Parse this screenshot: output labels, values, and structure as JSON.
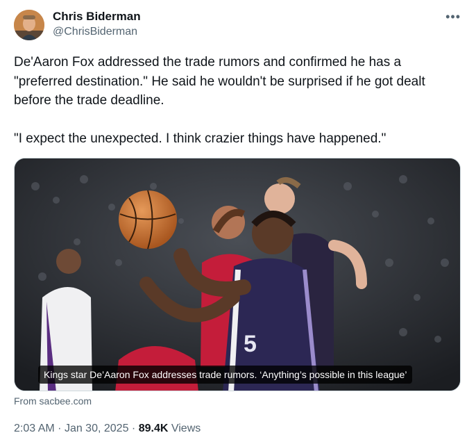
{
  "author": {
    "display_name": "Chris Biderman",
    "handle": "@ChrisBiderman"
  },
  "more_icon": "more-horizontal-icon",
  "tweet": {
    "text": "De'Aaron Fox addressed the trade rumors and confirmed he has a \"preferred destination.\" He said he wouldn't be surprised if he got dealt before the trade deadline.\n\n\"I expect the unexpected. I think crazier things have happened.\""
  },
  "media": {
    "caption": "Kings star De’Aaron Fox addresses trade rumors. ‘Anything’s possible in this league’",
    "jersey_number": "5"
  },
  "link_source": "From sacbee.com",
  "meta": {
    "time": "2:03 AM",
    "separator": "·",
    "date": "Jan 30, 2025",
    "views_count": "89.4K",
    "views_label": "Views"
  },
  "colors": {
    "text_primary": "#0f1419",
    "text_secondary": "#536471",
    "border": "#cfd9de",
    "kings_purple": "#5a2d81",
    "rockets_red": "#ce1141"
  }
}
